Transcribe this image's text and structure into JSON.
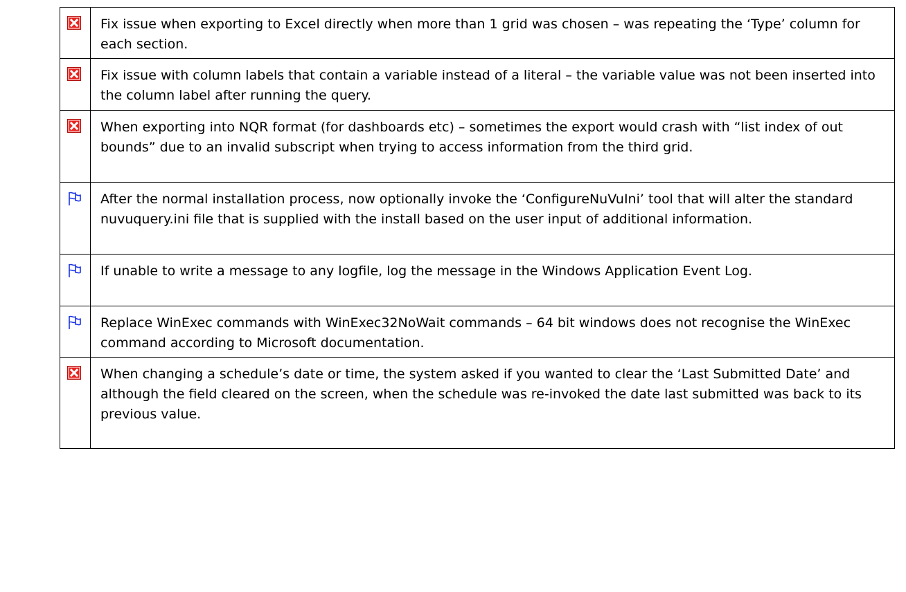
{
  "colors": {
    "bug_icon_fill": "#e8231f",
    "feature_icon_stroke": "#1a33e8",
    "border": "#000000",
    "text": "#000000"
  },
  "rows": [
    {
      "icon": "bug-fix-icon",
      "text": "Fix issue when exporting to Excel directly when more than 1 grid was chosen – was repeating the ‘Type’ column for each section."
    },
    {
      "icon": "bug-fix-icon",
      "text": "Fix issue with column labels that contain a variable instead of a literal – the variable value was not been inserted into the column label after running the query."
    },
    {
      "icon": "bug-fix-icon",
      "text": "When exporting into NQR format (for dashboards etc) – sometimes the export would crash with “list index of out bounds” due to an invalid subscript when trying to access information from the third grid."
    },
    {
      "icon": "new-feature-flag-icon",
      "text": "After the normal installation process, now optionally invoke the ‘ConfigureNuVuIni’ tool that will alter the standard nuvuquery.ini file that is supplied with the install based on the user input of additional information."
    },
    {
      "icon": "new-feature-flag-icon",
      "text": "If unable to write a message to any logfile, log the message in the Windows Application Event Log."
    },
    {
      "icon": "new-feature-flag-icon",
      "text": "Replace WinExec commands with WinExec32NoWait commands – 64 bit windows does not recognise the WinExec command according to Microsoft documentation."
    },
    {
      "icon": "bug-fix-icon",
      "text": "When changing a schedule’s date or time, the system asked if you wanted to clear the ‘Last Submitted Date’ and although the field cleared on the screen, when the schedule was re-invoked the date last submitted was back to its previous value."
    }
  ]
}
